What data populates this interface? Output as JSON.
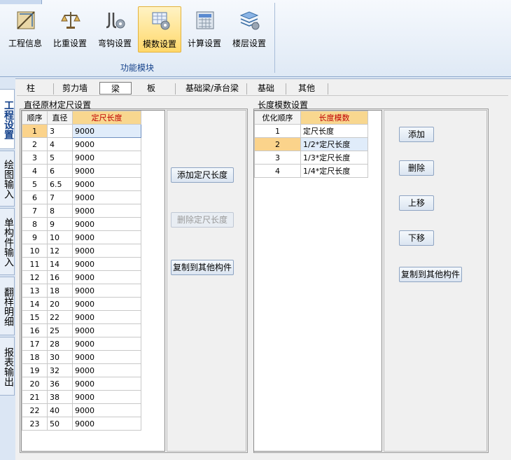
{
  "ribbon": {
    "buttons": [
      {
        "label": "工程信息",
        "icon": "ruler-icon"
      },
      {
        "label": "比重设置",
        "icon": "scale-icon"
      },
      {
        "label": "弯钩设置",
        "icon": "hook-gear-icon"
      },
      {
        "label": "模数设置",
        "icon": "module-gear-icon",
        "selected": true
      },
      {
        "label": "计算设置",
        "icon": "calculator-icon"
      },
      {
        "label": "楼层设置",
        "icon": "floors-gear-icon"
      }
    ],
    "group_label": "功能模块"
  },
  "side_tabs": [
    "工程设置",
    "绘图输入",
    "单构件输入",
    "翻样明细",
    "报表输出"
  ],
  "component_tabs": [
    "柱",
    "剪力墙",
    "梁",
    "板",
    "基础梁/承台梁",
    "基础",
    "其他"
  ],
  "selected_component_tab": "梁",
  "diameter_panel": {
    "title": "直径原材定尺设置",
    "headers": [
      "顺序",
      "直径",
      "定尺长度"
    ],
    "rows": [
      [
        "1",
        "3",
        "9000"
      ],
      [
        "2",
        "4",
        "9000"
      ],
      [
        "3",
        "5",
        "9000"
      ],
      [
        "4",
        "6",
        "9000"
      ],
      [
        "5",
        "6.5",
        "9000"
      ],
      [
        "6",
        "7",
        "9000"
      ],
      [
        "7",
        "8",
        "9000"
      ],
      [
        "8",
        "9",
        "9000"
      ],
      [
        "9",
        "10",
        "9000"
      ],
      [
        "10",
        "12",
        "9000"
      ],
      [
        "11",
        "14",
        "9000"
      ],
      [
        "12",
        "16",
        "9000"
      ],
      [
        "13",
        "18",
        "9000"
      ],
      [
        "14",
        "20",
        "9000"
      ],
      [
        "15",
        "22",
        "9000"
      ],
      [
        "16",
        "25",
        "9000"
      ],
      [
        "17",
        "28",
        "9000"
      ],
      [
        "18",
        "30",
        "9000"
      ],
      [
        "19",
        "32",
        "9000"
      ],
      [
        "20",
        "36",
        "9000"
      ],
      [
        "21",
        "38",
        "9000"
      ],
      [
        "22",
        "40",
        "9000"
      ],
      [
        "23",
        "50",
        "9000"
      ]
    ],
    "buttons": {
      "add": "添加定尺长度",
      "delete": "删除定尺长度",
      "copy": "复制到其他构件"
    }
  },
  "length_panel": {
    "title": "长度模数设置",
    "headers": [
      "优化顺序",
      "长度模数"
    ],
    "rows": [
      [
        "1",
        "定尺长度"
      ],
      [
        "2",
        "1/2*定尺长度"
      ],
      [
        "3",
        "1/3*定尺长度"
      ],
      [
        "4",
        "1/4*定尺长度"
      ]
    ],
    "buttons": {
      "add": "添加",
      "delete": "删除",
      "up": "上移",
      "down": "下移",
      "copy": "复制到其他构件"
    }
  },
  "colors": {
    "header_highlight": "#f8d78f",
    "header_text": "#c00000",
    "current_row": "#fbd38b",
    "ribbon_selected": "#ffd86a"
  }
}
